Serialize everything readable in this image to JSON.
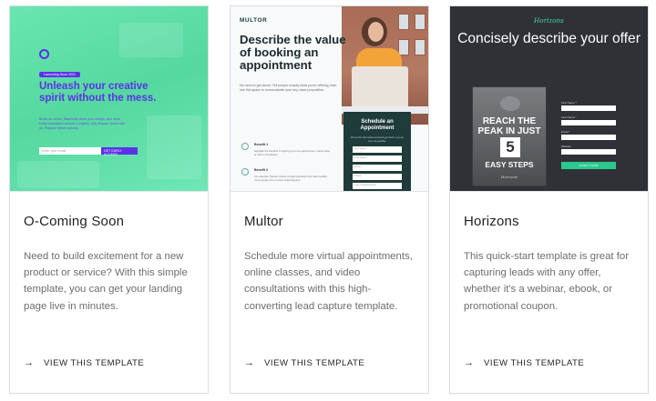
{
  "cards": [
    {
      "title": "O-Coming Soon",
      "description": "Need to build excitement for a new product or service? With this simple template, you can get your landing page live in minutes.",
      "cta": "VIEW THIS TEMPLATE",
      "thumbnail": {
        "pill": "Launching Soon 2021",
        "headline": "Unleash your creative spirit without the mess.",
        "copy": "Brush on colors, flawlessly blend your design, and more. Learn Inspiration around a brighter, fully sharper home with us. Prepare before Autumn.",
        "email_placeholder": "Enter your email",
        "button": "GET EARLY ACCESS"
      }
    },
    {
      "title": "Multor",
      "description": "Schedule more virtual appointments, online classes, and video consultations with this high-converting lead capture template.",
      "cta": "VIEW THIS TEMPLATE",
      "thumbnail": {
        "brand": "MULTOR",
        "headline": "Describe the value of booking an appointment",
        "sub": "No need to get clever. Tell people exactly what you're offering, then use this space to communicate your key value proposition.",
        "form_title": "Schedule an Appointment",
        "form_desc": "Fill out the form below and we'll get back to you as soon as possible.",
        "fields": [
          "First name",
          "Last Name",
          "Email",
          "Phone",
          "Type of Appointment"
        ],
        "benefits": [
          {
            "title": "Benefit 1",
            "copy": "Highlight the benefits of signing up for an appointment, online class, or other consultation."
          },
          {
            "title": "Benefit 2",
            "copy": "For example, Please include a bright checklist here that provides more people time to know what happens."
          }
        ]
      }
    },
    {
      "title": "Horizons",
      "description": "This quick-start template is great for capturing leads with any offer, whether it's a webinar, ebook, or promotional coupon.",
      "cta": "VIEW THIS TEMPLATE",
      "thumbnail": {
        "brand": "Horizons",
        "headline": "Concisely describe your offer",
        "book_line1": "REACH THE PEAK IN JUST",
        "book_number": "5",
        "book_line2": "EASY STEPS",
        "book_brand": "Horizons",
        "field_labels": [
          "First Name *",
          "Last Name *",
          "Email *",
          "Website"
        ],
        "button": "CLAIM IT NOW"
      }
    }
  ],
  "colors": {
    "card_border": "#d9dde2",
    "oc_green": "#5de0a6",
    "oc_purple": "#5a32e8",
    "multor_dark": "#1f3b3a",
    "horizons_bg": "#2f3136",
    "horizons_accent": "#2bc98f"
  },
  "icons": {
    "cta": "arrow-right-icon"
  }
}
